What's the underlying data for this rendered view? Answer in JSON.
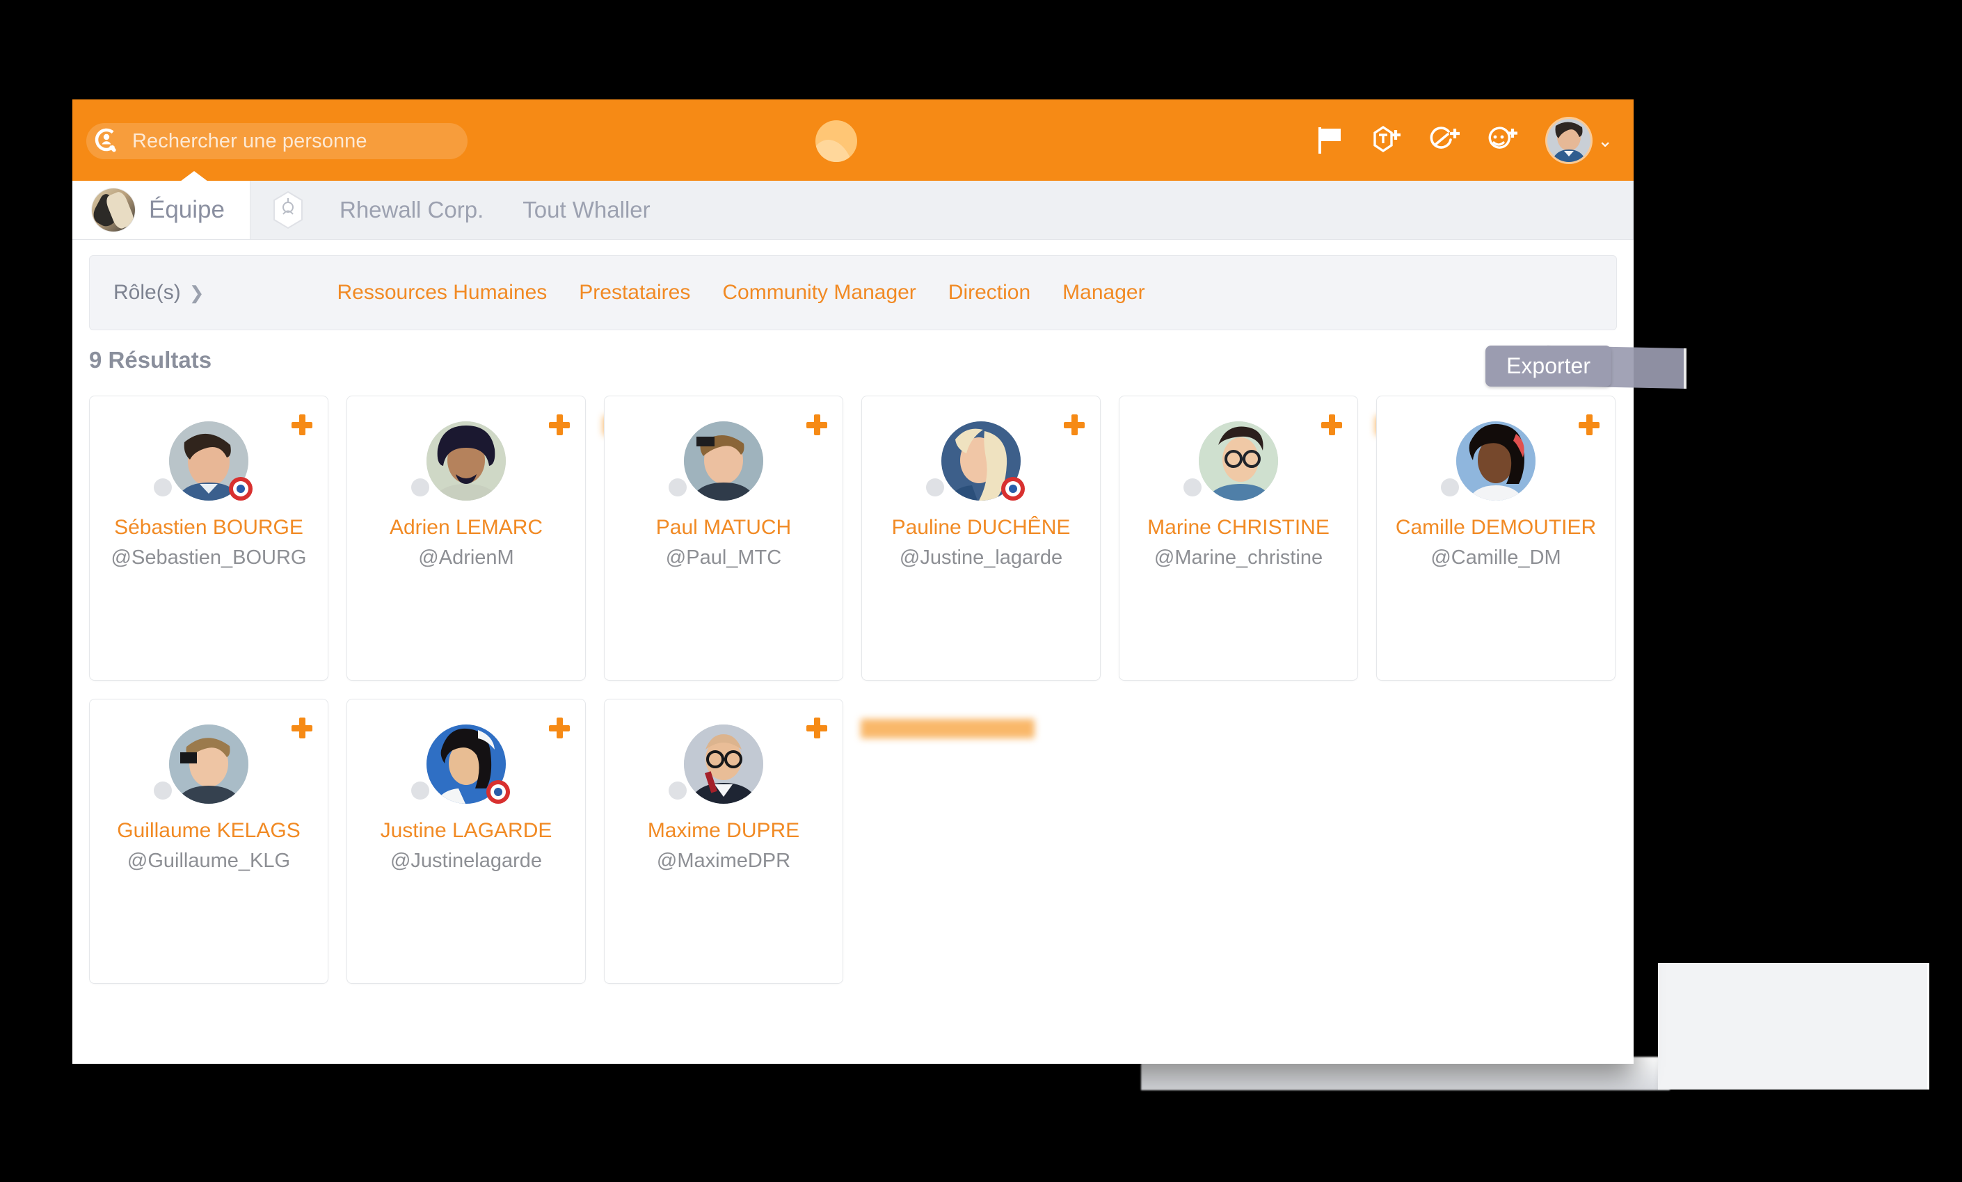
{
  "header": {
    "search": {
      "placeholder": "Rechercher une personne",
      "icon": "person-search-icon"
    },
    "brand_logo_name": "whaller-logo",
    "actions": [
      {
        "name": "flag-icon",
        "label": "Drapeau"
      },
      {
        "name": "add-sphere-icon",
        "label": "Créer une sphère"
      },
      {
        "name": "add-circle-icon",
        "label": "Créer un réseau"
      },
      {
        "name": "add-contact-icon",
        "label": "Ajouter un contact"
      }
    ],
    "user_menu": {
      "avatar_name": "user-avatar",
      "caret": "⌄"
    },
    "accent": "#f68a15"
  },
  "tabs": {
    "active": {
      "label": "Équipe",
      "avatar_name": "equipe-avatar"
    },
    "items": [
      {
        "label": "Rhewall Corp.",
        "icon": "hexagon-logo-icon"
      },
      {
        "label": "Tout Whaller"
      }
    ]
  },
  "filters": {
    "label": "Rôle(s)",
    "caret": "❯",
    "roles": [
      "Ressources Humaines",
      "Prestataires",
      "Community Manager",
      "Direction",
      "Manager"
    ],
    "role_color": "#f18a24"
  },
  "results": {
    "count_label": "9 Résultats",
    "export_label": "Exporter"
  },
  "people": [
    {
      "name": "Sébastien BOURGE",
      "handle": "@Sebastien_BOURG",
      "status": "offline",
      "verified": true,
      "tooltip": false,
      "face": "m1"
    },
    {
      "name": "Adrien LEMARC",
      "handle": "@AdrienM",
      "status": "offline",
      "verified": false,
      "tooltip": true,
      "tooltip_width": 110,
      "face": "m2"
    },
    {
      "name": "Paul MATUCH",
      "handle": "@Paul_MTC",
      "status": "offline",
      "verified": false,
      "tooltip": false,
      "face": "m3"
    },
    {
      "name": "Pauline DUCHÊNE",
      "handle": "@Justine_lagarde",
      "status": "offline",
      "verified": true,
      "tooltip": false,
      "face": "f1"
    },
    {
      "name": "Marine CHRISTINE",
      "handle": "@Marine_christine",
      "status": "offline",
      "verified": false,
      "tooltip": true,
      "tooltip_width": 150,
      "face": "f2"
    },
    {
      "name": "Camille DEMOUTIER",
      "handle": "@Camille_DM",
      "status": "offline",
      "verified": false,
      "tooltip": false,
      "face": "f3"
    },
    {
      "name": "Guillaume KELAGS",
      "handle": "@Guillaume_KLG",
      "status": "offline",
      "verified": false,
      "tooltip": false,
      "face": "m4"
    },
    {
      "name": "Justine LAGARDE",
      "handle": "@Justinelagarde",
      "status": "offline",
      "verified": true,
      "tooltip": false,
      "face": "f4"
    },
    {
      "name": "Maxime DUPRE",
      "handle": "@MaximeDPR",
      "status": "offline",
      "verified": false,
      "tooltip": true,
      "tooltip_width": 250,
      "face": "m5"
    }
  ]
}
